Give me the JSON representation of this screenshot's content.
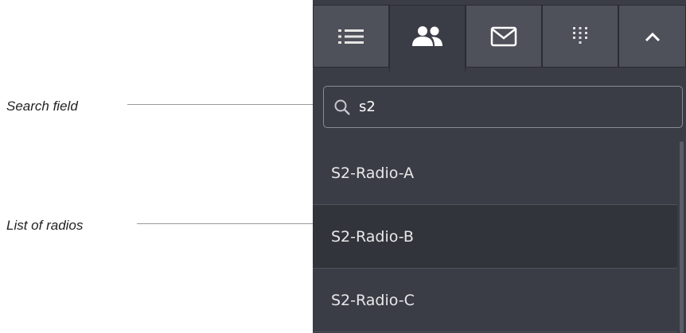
{
  "callouts": {
    "search_label": "Search field",
    "list_label": "List of radios"
  },
  "tabs": [
    {
      "icon": "list-icon"
    },
    {
      "icon": "users-icon",
      "active": true
    },
    {
      "icon": "mail-icon"
    },
    {
      "icon": "dialpad-icon"
    },
    {
      "icon": "chevron-up-icon"
    }
  ],
  "search": {
    "value": "s2"
  },
  "radios": [
    {
      "label": "S2-Radio-A"
    },
    {
      "label": "S2-Radio-B"
    },
    {
      "label": "S2-Radio-C"
    }
  ],
  "colors": {
    "panel_bg": "#3b3d46",
    "tab_bg": "#4e505a",
    "selected_row": "#32343c",
    "text": "#e8e8ea"
  }
}
